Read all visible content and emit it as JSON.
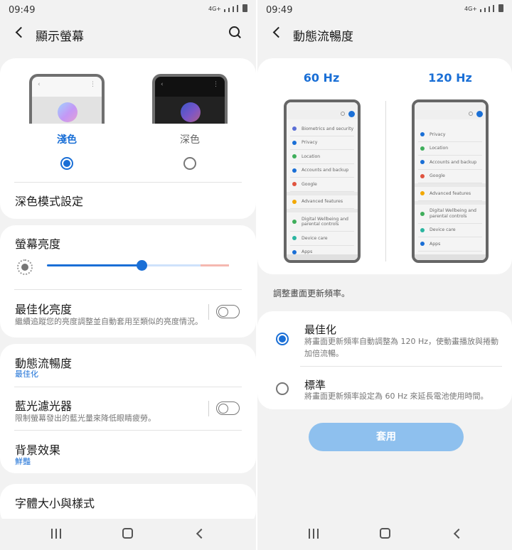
{
  "left": {
    "status": {
      "time": "09:49",
      "net": "4G+"
    },
    "appbar": {
      "title": "顯示螢幕"
    },
    "theme": {
      "light_label": "淺色",
      "dark_label": "深色",
      "selected": "light",
      "dark_mode_settings": "深色模式設定"
    },
    "brightness": {
      "title": "螢幕亮度",
      "level": 0.52,
      "adaptive_title": "最佳化亮度",
      "adaptive_desc": "繼續追蹤您的亮度調整並自動套用至類似的亮度情況。",
      "adaptive_on": false
    },
    "motion": {
      "title": "動態流暢度",
      "value": "最佳化"
    },
    "blue_light": {
      "title": "藍光濾光器",
      "desc": "限制螢幕發出的藍光量來降低眼睛疲勞。",
      "on": false
    },
    "screen_mode": {
      "title": "背景效果",
      "value": "鮮豔"
    },
    "font": {
      "title": "字體大小與樣式"
    }
  },
  "right": {
    "status": {
      "time": "09:49",
      "net": "4G+"
    },
    "appbar": {
      "title": "動態流暢度"
    },
    "preview": {
      "left_label": "60 Hz",
      "right_label": "120 Hz",
      "items_60": [
        "Biometrics and security",
        "Privacy",
        "Location",
        "Accounts and backup",
        "Google",
        "Advanced features",
        "Digital Wellbeing and parental controls",
        "Device care",
        "Apps"
      ],
      "items_120": [
        "Privacy",
        "Location",
        "Accounts and backup",
        "Google",
        "Advanced features",
        "Digital Wellbeing and parental controls",
        "Device care",
        "Apps"
      ]
    },
    "caption": "調整畫面更新頻率。",
    "options": [
      {
        "title": "最佳化",
        "desc": "將畫面更新頻率自動調整為 120 Hz，使動畫播放與捲動加倍流暢。",
        "selected": true
      },
      {
        "title": "標準",
        "desc": "將畫面更新頻率設定為 60 Hz 來延長電池使用時間。",
        "selected": false
      }
    ],
    "apply_label": "套用"
  },
  "colors": {
    "accent": "#1a6fd6",
    "apply_bg": "#8ec0ee"
  },
  "icons": [
    "back-icon",
    "search-icon",
    "brightness-icon",
    "recent-apps-icon",
    "home-icon",
    "nav-back-icon",
    "profile-icon"
  ]
}
